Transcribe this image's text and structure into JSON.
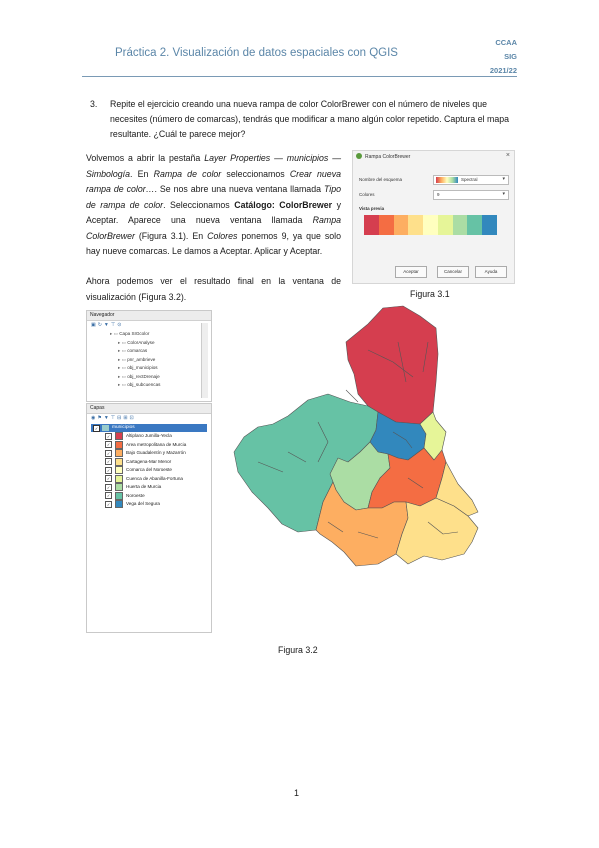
{
  "header": {
    "title": "Práctica 2. Visualización de datos espaciales con QGIS",
    "right_lines": [
      "CCAA",
      "SIG",
      "2021/22"
    ]
  },
  "exercise": {
    "number": "3.",
    "text": "Repite el ejercicio creando una nueva rampa de color ColorBrewer con el número de niveles que necesites (número de comarcas), tendrás que modificar a mano algún color repetido. Captura el mapa resultante. ¿Cuál te parece mejor?"
  },
  "paragraph1": {
    "p1": "Volvemos a abrir la pestaña ",
    "p2": "Layer Properties — municipios — Simbología",
    "p3": ". En ",
    "p4": "Rampa de color",
    "p5": " seleccionamos ",
    "p6": "Crear nueva rampa de color…",
    "p7": ". Se nos abre una nueva ventana llamada ",
    "p8": "Tipo de rampa de color",
    "p9": ". Seleccionamos ",
    "p10": "Catálogo: ColorBrewer",
    "p11": " y Aceptar. Aparece una nueva ventana llamada ",
    "p12": "Rampa ColorBrewer",
    "p13": " (Figura 3.1). En ",
    "p14": "Colores",
    "p15": " ponemos 9, ya que solo hay nueve comarcas. Le damos a Aceptar. Aplicar y Aceptar."
  },
  "paragraph2": "Ahora podemos ver el resultado final en la ventana de visualización (Figura 3.2).",
  "dialog": {
    "title": "Rampa ColorBrewer",
    "close": "×",
    "scheme_label": "Nombre del esquema",
    "scheme_value": "Spectral",
    "colors_label": "Colores",
    "colors_value": "9",
    "preview_label": "Vista previa",
    "buttons": [
      "Aceptar",
      "Cancelar",
      "Ayuda"
    ],
    "ramp_colors": [
      "#d53e4f",
      "#f46d43",
      "#fdae61",
      "#fee08b",
      "#ffffbf",
      "#e6f598",
      "#abdda4",
      "#66c2a5",
      "#3288bd"
    ]
  },
  "figure_3_1_caption": "Figura 3.1",
  "figure_3_2_caption": "Figura 3.2",
  "navigator": {
    "title": "Navegador",
    "items": [
      "Capa SIGcolor",
      "ColorAnalyse",
      "comarcas",
      "pnr_ambrieve",
      "obj_municipios",
      "obj_rectDrenaje",
      "obj_subcuencas"
    ]
  },
  "layers": {
    "title": "Capas",
    "layer_name": "municipios",
    "legend": [
      {
        "label": "Altiplano Jumilla-Yecla",
        "color": "#d53e4f"
      },
      {
        "label": "Area metropolitana de Murcia",
        "color": "#f46d43"
      },
      {
        "label": "Bajo Guadalentín y Mazarrón",
        "color": "#fdae61"
      },
      {
        "label": "Cartagena-Mar Menor",
        "color": "#fee08b"
      },
      {
        "label": "Comarca del Noroeste",
        "color": "#ffffbf"
      },
      {
        "label": "Cuenca de Abanilla-Fortuna",
        "color": "#e6f598"
      },
      {
        "label": "Huerta de Murcia",
        "color": "#abdda4"
      },
      {
        "label": "Noroeste",
        "color": "#66c2a5"
      },
      {
        "label": "Vega del Segura",
        "color": "#3288bd"
      }
    ]
  },
  "page_number": "1"
}
